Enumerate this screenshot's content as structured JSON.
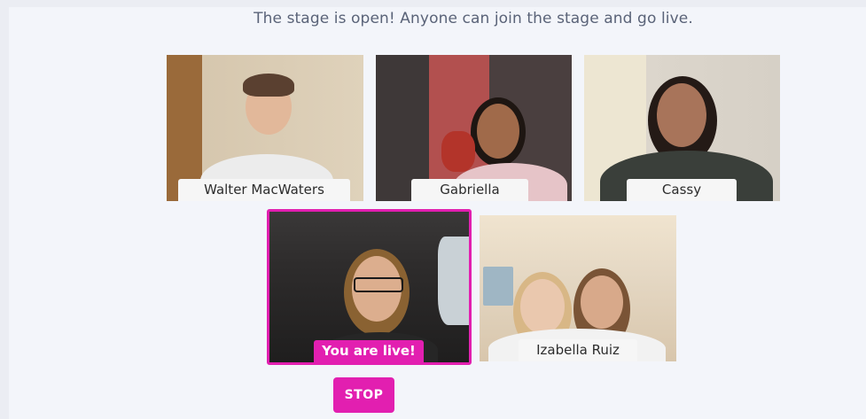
{
  "stage": {
    "banner": "The stage is open! Anyone can join the stage and go live."
  },
  "participants": [
    {
      "name": "Walter MacWaters"
    },
    {
      "name": "Gabriella"
    },
    {
      "name": "Cassy"
    },
    {
      "name": "You are live!",
      "is_self": true
    },
    {
      "name": "Izabella Ruiz"
    }
  ],
  "controls": {
    "stop_label": "STOP"
  },
  "colors": {
    "accent": "#e21fb0",
    "background": "#f3f5fa",
    "banner_text": "#5a6378"
  }
}
